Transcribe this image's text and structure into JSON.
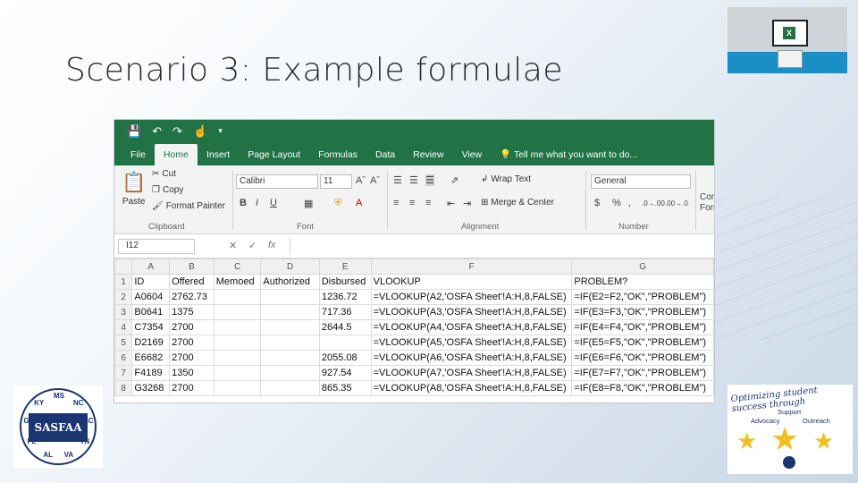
{
  "slide": {
    "title": "Scenario 3:  Example formulae"
  },
  "excel": {
    "qat": {
      "save_icon": "save-icon",
      "undo_icon": "undo-icon",
      "touch_icon": "touch-mode-icon"
    },
    "tabs": [
      "File",
      "Home",
      "Insert",
      "Page Layout",
      "Formulas",
      "Data",
      "Review",
      "View"
    ],
    "active_tab": "Home",
    "tell_me": "Tell me what you want to do...",
    "ribbon": {
      "paste": "Paste",
      "cut": "Cut",
      "copy": "Copy",
      "format_painter": "Format Painter",
      "clipboard": "Clipboard",
      "font_name": "Calibri",
      "font_size": "11",
      "font": "Font",
      "bold": "B",
      "italic": "I",
      "underline": "U",
      "wrap_text": "Wrap Text",
      "merge_center": "Merge & Center",
      "alignment": "Alignment",
      "number_format": "General",
      "number": "Number",
      "currency": "$",
      "percent": "%",
      "comma": ",",
      "inc_dec": ".0→.00",
      "dec_dec": ".00→.0",
      "cond": "Cor",
      "cond2": "Forr"
    },
    "namebox": "I12",
    "fx": "fx",
    "columns": [
      "A",
      "B",
      "C",
      "D",
      "E",
      "F",
      "G"
    ],
    "rows": [
      {
        "n": "1",
        "cells": [
          "ID",
          "Offered",
          "Memoed",
          "Authorized",
          "Disbursed",
          "VLOOKUP",
          "PROBLEM?"
        ]
      },
      {
        "n": "2",
        "cells": [
          "A0604",
          "2762.73",
          "",
          "",
          "1236.72",
          "=VLOOKUP(A2,'OSFA Sheet'!A:H,8,FALSE)",
          "=IF(E2=F2,\"OK\",\"PROBLEM\")"
        ]
      },
      {
        "n": "3",
        "cells": [
          "B0641",
          "1375",
          "",
          "",
          "717.36",
          "=VLOOKUP(A3,'OSFA Sheet'!A:H,8,FALSE)",
          "=IF(E3=F3,\"OK\",\"PROBLEM\")"
        ]
      },
      {
        "n": "4",
        "cells": [
          "C7354",
          "2700",
          "",
          "",
          "2644.5",
          "=VLOOKUP(A4,'OSFA Sheet'!A:H,8,FALSE)",
          "=IF(E4=F4,\"OK\",\"PROBLEM\")"
        ]
      },
      {
        "n": "5",
        "cells": [
          "D2169",
          "2700",
          "",
          "",
          "",
          "=VLOOKUP(A5,'OSFA Sheet'!A:H,8,FALSE)",
          "=IF(E5=F5,\"OK\",\"PROBLEM\")"
        ]
      },
      {
        "n": "6",
        "cells": [
          "E6682",
          "2700",
          "",
          "",
          "2055.08",
          "=VLOOKUP(A6,'OSFA Sheet'!A:H,8,FALSE)",
          "=IF(E6=F6,\"OK\",\"PROBLEM\")"
        ]
      },
      {
        "n": "7",
        "cells": [
          "F4189",
          "1350",
          "",
          "",
          "927.54",
          "=VLOOKUP(A7,'OSFA Sheet'!A:H,8,FALSE)",
          "=IF(E7=F7,\"OK\",\"PROBLEM\")"
        ]
      },
      {
        "n": "8",
        "cells": [
          "G3268",
          "2700",
          "",
          "",
          "865.35",
          "=VLOOKUP(A8,'OSFA Sheet'!A:H,8,FALSE)",
          "=IF(E8=F8,\"OK\",\"PROBLEM\")"
        ]
      }
    ]
  },
  "logos": {
    "sasfaa": "SASFAA",
    "sasfaa_letters": [
      "AL",
      "FL",
      "GA",
      "KY",
      "MS",
      "NC",
      "SC",
      "TN",
      "VA"
    ],
    "right_script": "Optimizing student success through",
    "right_words": [
      "Support",
      "Advocacy",
      "Outreach"
    ]
  },
  "colors": {
    "excel_green": "#217346",
    "brand_navy": "#1a3570"
  }
}
